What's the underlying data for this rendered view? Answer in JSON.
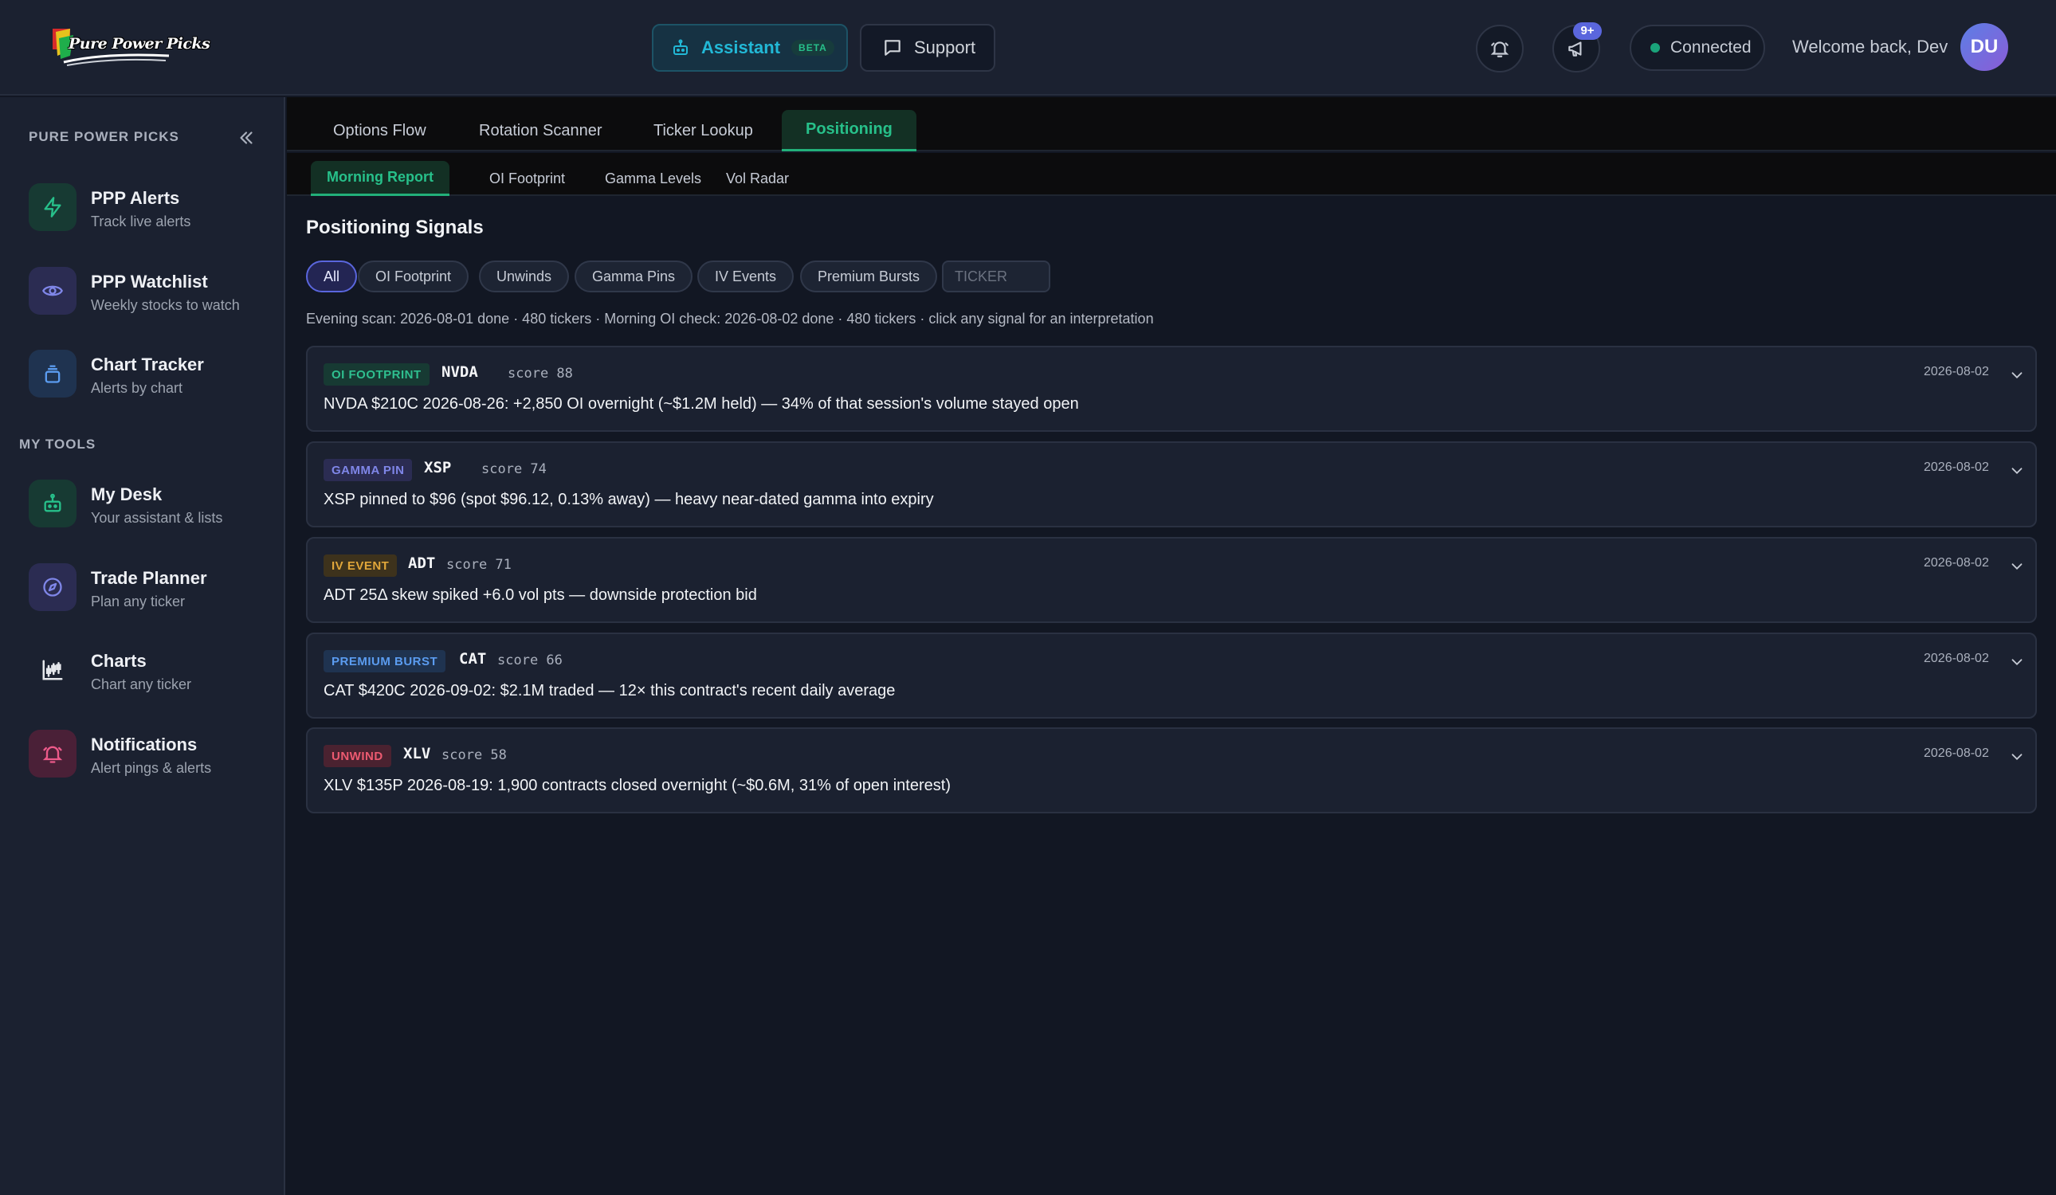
{
  "header": {
    "logo_text": "Pure Power Picks",
    "assistant_label": "Assistant",
    "beta_label": "BETA",
    "support_label": "Support",
    "announcements_badge": "9+",
    "connection_status": "Connected",
    "welcome_text": "Welcome back, Dev",
    "avatar_initials": "DU"
  },
  "sidebar": {
    "brand": "PURE POWER PICKS",
    "section_tools": "MY TOOLS",
    "items": [
      {
        "title": "PPP Alerts",
        "subtitle": "Track live alerts",
        "icon": "lightning-icon"
      },
      {
        "title": "PPP Watchlist",
        "subtitle": "Weekly stocks to watch",
        "icon": "eye-icon"
      },
      {
        "title": "Chart Tracker",
        "subtitle": "Alerts by chart",
        "icon": "layers-icon"
      },
      {
        "title": "My Desk",
        "subtitle": "Your assistant & lists",
        "icon": "robot-icon"
      },
      {
        "title": "Trade Planner",
        "subtitle": "Plan any ticker",
        "icon": "compass-icon"
      },
      {
        "title": "Charts",
        "subtitle": "Chart any ticker",
        "icon": "candlestick-icon"
      },
      {
        "title": "Notifications",
        "subtitle": "Alert pings & alerts",
        "icon": "bell-icon"
      }
    ]
  },
  "main": {
    "tabs": [
      "Options Flow",
      "Rotation Scanner",
      "Ticker Lookup",
      "Positioning"
    ],
    "active_tab": "Positioning",
    "subtabs": [
      "Morning Report",
      "OI Footprint",
      "Gamma Levels",
      "Vol Radar"
    ],
    "active_subtab": "Morning Report",
    "heading": "Positioning Signals",
    "filters": [
      "All",
      "OI Footprint",
      "Unwinds",
      "Gamma Pins",
      "IV Events",
      "Premium Bursts"
    ],
    "active_filter": "All",
    "ticker_placeholder": "TICKER",
    "scan_status": "Evening scan: 2026-08-01 done · 480 tickers · Morning OI check: 2026-08-02 done · 480 tickers · click any signal for an interpretation",
    "signals": [
      {
        "tag": "OI FOOTPRINT",
        "symbol": "NVDA",
        "score": "score 88",
        "date": "2026-08-02",
        "text": "NVDA $210C 2026-08-26: +2,850 OI overnight (~$1.2M held) — 34% of that session's volume stayed open"
      },
      {
        "tag": "GAMMA PIN",
        "symbol": "XSP",
        "score": "score 74",
        "date": "2026-08-02",
        "text": "XSP pinned to $96 (spot $96.12, 0.13% away) — heavy near-dated gamma into expiry"
      },
      {
        "tag": "IV EVENT",
        "symbol": "ADT",
        "score": "score 71",
        "date": "2026-08-02",
        "text": "ADT 25Δ skew spiked +6.0 vol pts — downside protection bid"
      },
      {
        "tag": "PREMIUM BURST",
        "symbol": "CAT",
        "score": "score 66",
        "date": "2026-08-02",
        "text": "CAT $420C 2026-09-02: $2.1M traded — 12× this contract's recent daily average"
      },
      {
        "tag": "UNWIND",
        "symbol": "XLV",
        "score": "score 58",
        "date": "2026-08-02",
        "text": "XLV $135P 2026-08-19: 1,900 contracts closed overnight (~$0.6M, 31% of open interest)"
      }
    ]
  },
  "colors": {
    "accent_green": "#27c08a",
    "accent_cyan": "#22b8d6",
    "accent_indigo": "#5a66dd",
    "tag_oi_footprint": "#2fbf8f",
    "tag_gamma_pin": "#7f86e8",
    "tag_iv_event": "#e0a63a",
    "tag_premium_burst": "#5b9cf0",
    "tag_unwind": "#ec5a70"
  }
}
